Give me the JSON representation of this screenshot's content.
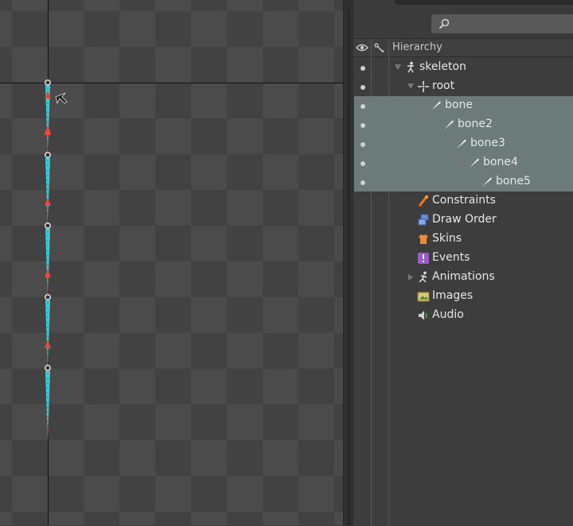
{
  "hierarchy": {
    "header": "Hierarchy",
    "rows": [
      {
        "label": "skeleton",
        "icon": "skeleton-icon",
        "visible": true,
        "selected": false
      },
      {
        "label": "root",
        "icon": "root-bone-icon",
        "visible": true,
        "selected": false
      },
      {
        "label": "bone",
        "icon": "bone-icon",
        "visible": true,
        "selected": true
      },
      {
        "label": "bone2",
        "icon": "bone-icon",
        "visible": true,
        "selected": true
      },
      {
        "label": "bone3",
        "icon": "bone-icon",
        "visible": true,
        "selected": true
      },
      {
        "label": "bone4",
        "icon": "bone-icon",
        "visible": true,
        "selected": true
      },
      {
        "label": "bone5",
        "icon": "bone-icon",
        "visible": true,
        "selected": true
      },
      {
        "label": "Constraints",
        "icon": "constraints-icon"
      },
      {
        "label": "Draw Order",
        "icon": "draw-order-icon"
      },
      {
        "label": "Skins",
        "icon": "skins-icon"
      },
      {
        "label": "Events",
        "icon": "events-icon"
      },
      {
        "label": "Animations",
        "icon": "animations-icon"
      },
      {
        "label": "Images",
        "icon": "images-icon"
      },
      {
        "label": "Audio",
        "icon": "audio-icon"
      }
    ]
  },
  "colors": {
    "selection": "#6c7a7a",
    "bone": "#28d8e6",
    "ik_arrow": "#e8483e"
  }
}
